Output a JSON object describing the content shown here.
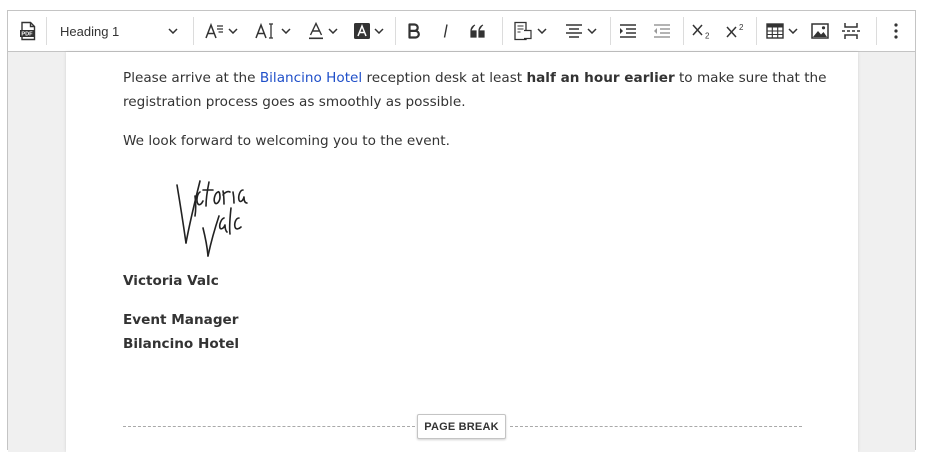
{
  "toolbar": {
    "heading_value": "Heading 1",
    "buttons": [
      {
        "icon": "pdf-icon",
        "label": "PDF"
      },
      {
        "icon": "font-size-icon"
      },
      {
        "icon": "font-family-icon"
      },
      {
        "icon": "font-color-icon"
      },
      {
        "icon": "font-background-color-icon"
      },
      {
        "icon": "bold-icon"
      },
      {
        "icon": "italic-icon"
      },
      {
        "icon": "block-quote-icon"
      },
      {
        "icon": "insert-template-icon"
      },
      {
        "icon": "align-icon"
      },
      {
        "icon": "indent-icon"
      },
      {
        "icon": "outdent-icon"
      },
      {
        "icon": "subscript-icon"
      },
      {
        "icon": "superscript-icon"
      },
      {
        "icon": "table-icon"
      },
      {
        "icon": "image-icon"
      },
      {
        "icon": "page-break-icon"
      },
      {
        "icon": "more-options-icon"
      }
    ]
  },
  "document": {
    "para1": {
      "before": "Please arrive at the ",
      "link": "Bilancino Hotel",
      "middle": " reception desk at least ",
      "bold": "half an hour earlier",
      "after_line1": " to make sure that the",
      "line2": "registration process goes as smoothly as possible."
    },
    "para2": "We look forward to welcoming you to the event.",
    "signature_text": "Victoria Valc",
    "name": "Victoria Valc",
    "title": "Event Manager",
    "company": "Bilancino Hotel",
    "page_break_label": "PAGE BREAK"
  },
  "colors": {
    "link": "#1f4fc9",
    "text": "#333333",
    "canvas": "#f0f0f0"
  }
}
